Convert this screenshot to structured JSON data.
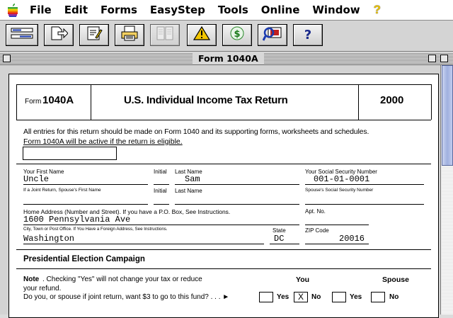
{
  "menubar": {
    "items": [
      "File",
      "Edit",
      "Forms",
      "EasyStep",
      "Tools",
      "Online",
      "Window"
    ],
    "help": "?"
  },
  "toolbar": {
    "buttons": [
      "navigator-icon",
      "forms-icon",
      "edit-form-icon",
      "print-icon",
      "documents-icon",
      "warning-icon",
      "money-icon",
      "online-icon",
      "help-icon"
    ],
    "help_label": "?"
  },
  "window": {
    "title": "Form 1040A"
  },
  "form": {
    "form_prefix": "Form",
    "form_number": "1040A",
    "form_title": "U.S. Individual Income Tax Return",
    "year": "2000",
    "notice_line1": "All entries for this return should be made on Form 1040 and its supporting forms, worksheets and schedules.",
    "notice_line2": "Form 1040A will be active if the return is eligible.",
    "first_name_label": "Your First Name",
    "initial_label": "Initial",
    "last_name_label": "Last Name",
    "ssn_label": "Your Social Security Number",
    "first_name": "Uncle",
    "last_name": "Sam",
    "ssn": "001-01-0001",
    "spouse_first_label": "If a Joint Return, Spouse's First Name",
    "spouse_initial_label": "Initial",
    "spouse_last_label": "Last Name",
    "spouse_ssn_label": "Spouse's Social Security Number",
    "address_label": "Home Address (Number and Street). If you have a  P.O. Box, See Instructions.",
    "apt_label": "Apt. No.",
    "address": "1600 Pennsylvania Ave",
    "city_label": "City, Town or Post Office. If You Have a Foreign Address, See Instructions.",
    "state_label": "State",
    "zip_label": "ZIP Code",
    "city": "Washington",
    "state": "DC",
    "zip": "20016",
    "pec_heading": "Presidential Election Campaign",
    "note_bold": "Note",
    "note_text": ". Checking \"Yes\" will not change your tax or reduce",
    "note_line2": "your refund.",
    "question": "Do you, or spouse if joint return, want $3 to go to this fund? . . . ►",
    "you_label": "You",
    "spouse_label": "Spouse",
    "yes_label": "Yes",
    "no_label": "No",
    "you_no_mark": "X"
  },
  "colors": {
    "accent_blue": "#9fb0df",
    "help_yellow": "#e8c000"
  }
}
